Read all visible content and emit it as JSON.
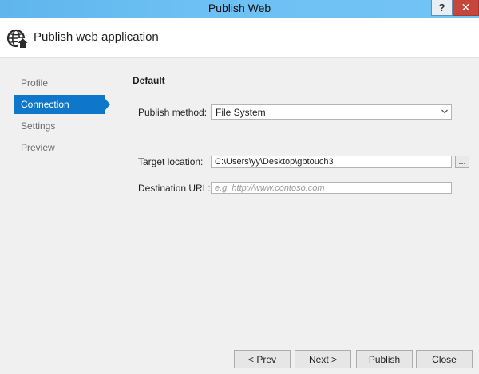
{
  "window": {
    "title": "Publish Web",
    "help_label": "?",
    "close_label": "✕"
  },
  "header": {
    "title": "Publish web application",
    "icon": "globe-arrow-icon"
  },
  "sidebar": {
    "items": [
      {
        "label": "Profile",
        "active": false
      },
      {
        "label": "Connection",
        "active": true
      },
      {
        "label": "Settings",
        "active": false
      },
      {
        "label": "Preview",
        "active": false
      }
    ]
  },
  "content": {
    "section_title": "Default",
    "publish_method": {
      "label": "Publish method:",
      "value": "File System"
    },
    "target_location": {
      "label": "Target location:",
      "value": "C:\\Users\\yy\\Desktop\\gbtouch3",
      "browse_label": "..."
    },
    "destination_url": {
      "label": "Destination URL:",
      "value": "",
      "placeholder": "e.g. http://www.contoso.com"
    }
  },
  "footer": {
    "prev_label": "< Prev",
    "next_label": "Next >",
    "publish_label": "Publish",
    "close_label": "Close"
  },
  "colors": {
    "accent": "#0e77c9",
    "titlebar": "#6cc0f3",
    "close_button": "#c7463b"
  }
}
